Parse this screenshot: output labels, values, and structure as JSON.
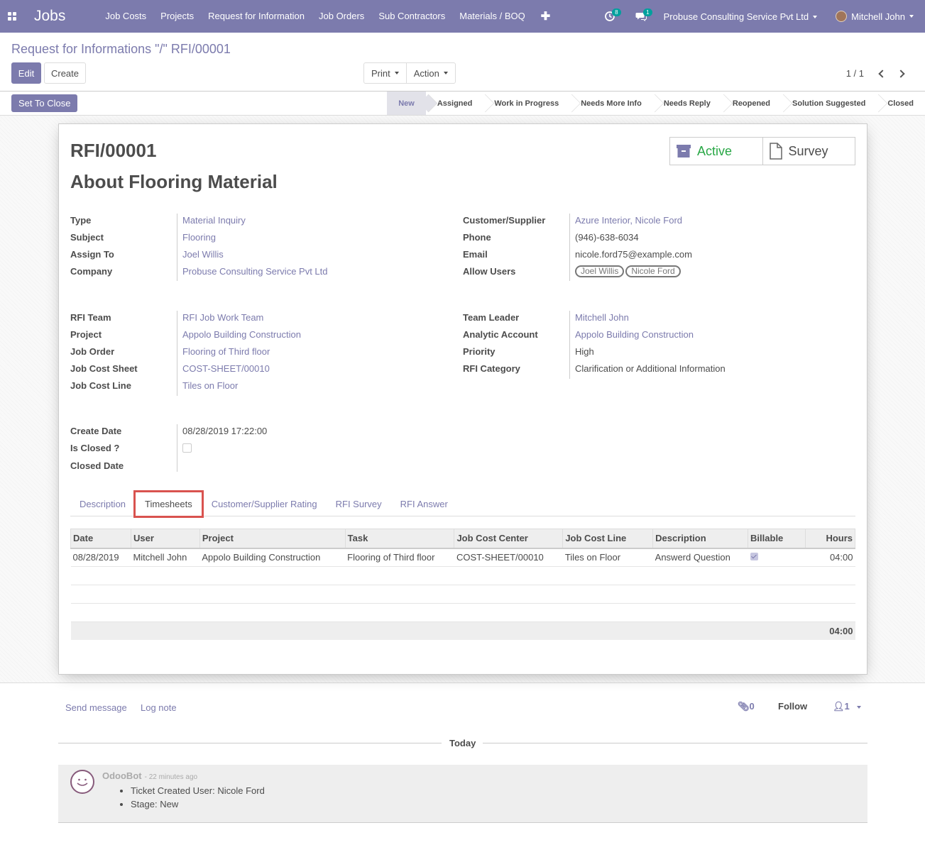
{
  "nav": {
    "brand": "Jobs",
    "menu": [
      "Job Costs",
      "Projects",
      "Request for Information",
      "Job Orders",
      "Sub Contractors",
      "Materials / BOQ"
    ],
    "activity_count": "8",
    "message_count": "1",
    "company": "Probuse Consulting Service Pvt Ltd",
    "user": "Mitchell John"
  },
  "control": {
    "breadcrumb": "Request for Informations \"/\" RFI/00001",
    "edit_label": "Edit",
    "create_label": "Create",
    "print_label": "Print",
    "action_label": "Action",
    "pager": "1 / 1"
  },
  "statusbar": {
    "close_button": "Set To Close",
    "stages": [
      "New",
      "Assigned",
      "Work in Progress",
      "Needs More Info",
      "Needs Reply",
      "Reopened",
      "Solution Suggested",
      "Closed"
    ],
    "active_stage": "New"
  },
  "smart_buttons": {
    "active_label": "Active",
    "survey_label": "Survey"
  },
  "record": {
    "name": "RFI/00001",
    "title": "About Flooring Material",
    "left1": [
      {
        "label": "Type",
        "value": "Material Inquiry"
      },
      {
        "label": "Subject",
        "value": "Flooring"
      },
      {
        "label": "Assign To",
        "value": "Joel Willis"
      },
      {
        "label": "Company",
        "value": "Probuse Consulting Service Pvt Ltd"
      }
    ],
    "right1": [
      {
        "label": "Customer/Supplier",
        "value": "Azure Interior, Nicole Ford"
      },
      {
        "label": "Phone",
        "value": "(946)-638-6034"
      },
      {
        "label": "Email",
        "value": "nicole.ford75@example.com"
      },
      {
        "label": "Allow Users",
        "tags": [
          "Joel Willis",
          "Nicole Ford"
        ]
      }
    ],
    "left2": [
      {
        "label": "RFI Team",
        "value": "RFI Job Work Team"
      },
      {
        "label": "Project",
        "value": "Appolo Building Construction"
      },
      {
        "label": "Job Order",
        "value": "Flooring of Third floor"
      },
      {
        "label": "Job Cost Sheet",
        "value": "COST-SHEET/00010"
      },
      {
        "label": "Job Cost Line",
        "value": "Tiles on Floor"
      }
    ],
    "right2": [
      {
        "label": "Team Leader",
        "value": "Mitchell John"
      },
      {
        "label": "Analytic Account",
        "value": "Appolo Building Construction"
      },
      {
        "label": "Priority",
        "value": "High"
      },
      {
        "label": "RFI Category",
        "value": "Clarification or Additional Information"
      }
    ],
    "left3": [
      {
        "label": "Create Date",
        "value": "08/28/2019 17:22:00"
      },
      {
        "label": "Is Closed ?",
        "value": ""
      },
      {
        "label": "Closed Date",
        "value": ""
      }
    ]
  },
  "tabs": [
    "Description",
    "Timesheets",
    "Customer/Supplier Rating",
    "RFI Survey",
    "RFI Answer"
  ],
  "timesheet": {
    "columns": [
      "Date",
      "User",
      "Project",
      "Task",
      "Job Cost Center",
      "Job Cost Line",
      "Description",
      "Billable",
      "Hours"
    ],
    "rows": [
      [
        "08/28/2019",
        "Mitchell John",
        "Appolo Building Construction",
        "Flooring of Third floor",
        "COST-SHEET/00010",
        "Tiles on Floor",
        "Answerd Question",
        "",
        "04:00"
      ]
    ],
    "total": "04:00"
  },
  "chatter": {
    "send_message": "Send message",
    "log_note": "Log note",
    "attachments": "0",
    "follow": "Follow",
    "followers": "1",
    "today": "Today",
    "author": "OdooBot",
    "time": "- 22 minutes ago",
    "lines": [
      "Ticket Created User: Nicole Ford",
      "Stage: New"
    ]
  }
}
